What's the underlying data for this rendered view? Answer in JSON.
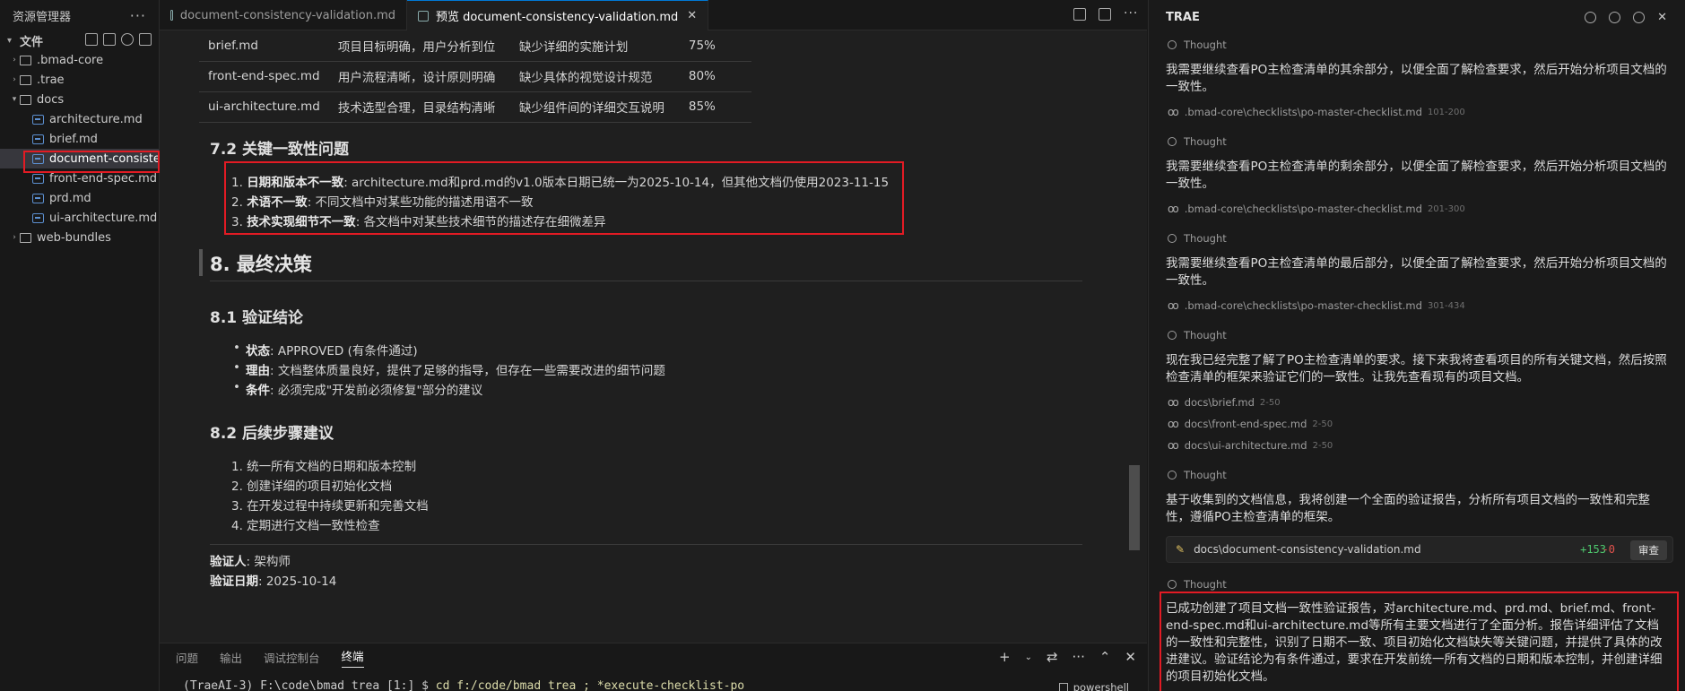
{
  "explorer": {
    "title": "资源管理器",
    "section": "文件",
    "items": [
      {
        "label": ".bmad-core",
        "type": "folder"
      },
      {
        "label": ".trae",
        "type": "folder"
      },
      {
        "label": "docs",
        "type": "folder-open"
      },
      {
        "label": "architecture.md",
        "type": "file"
      },
      {
        "label": "brief.md",
        "type": "file"
      },
      {
        "label": "document-consiste...",
        "type": "file"
      },
      {
        "label": "front-end-spec.md",
        "type": "file"
      },
      {
        "label": "prd.md",
        "type": "file"
      },
      {
        "label": "ui-architecture.md",
        "type": "file"
      },
      {
        "label": "web-bundles",
        "type": "folder"
      }
    ]
  },
  "tabs": [
    {
      "label": "document-consistency-validation.md"
    },
    {
      "label": "预览 document-consistency-validation.md"
    }
  ],
  "doc": {
    "table_rows": [
      [
        "brief.md",
        "项目目标明确，用户分析到位",
        "缺少详细的实施计划",
        "75%"
      ],
      [
        "front-end-spec.md",
        "用户流程清晰，设计原则明确",
        "缺少具体的视觉设计规范",
        "80%"
      ],
      [
        "ui-architecture.md",
        "技术选型合理，目录结构清晰",
        "缺少组件间的详细交互说明",
        "85%"
      ]
    ],
    "h72": "7.2 关键一致性问题",
    "issues": [
      {
        "num": "1.",
        "bold": "日期和版本不一致",
        "text": ": architecture.md和prd.md的v1.0版本日期已统一为2025-10-14，但其他文档仍使用2023-11-15"
      },
      {
        "num": "2.",
        "bold": "术语不一致",
        "text": ": 不同文档中对某些功能的描述用语不一致"
      },
      {
        "num": "3.",
        "bold": "技术实现细节不一致",
        "text": ": 各文档中对某些技术细节的描述存在细微差异"
      }
    ],
    "h8": "8. 最终决策",
    "h81": "8.1 验证结论",
    "conclusion": [
      {
        "bold": "状态",
        "text": ": APPROVED (有条件通过)"
      },
      {
        "bold": "理由",
        "text": ": 文档整体质量良好，提供了足够的指导，但存在一些需要改进的细节问题"
      },
      {
        "bold": "条件",
        "text": ": 必须完成\"开发前必须修复\"部分的建议"
      }
    ],
    "h82": "8.2 后续步骤建议",
    "steps": [
      "1. 统一所有文档的日期和版本控制",
      "2. 创建详细的项目初始化文档",
      "3. 在开发过程中持续更新和完善文档",
      "4. 定期进行文档一致性检查"
    ],
    "verifier_label": "验证人",
    "verifier": ": 架构师",
    "date_label": "验证日期",
    "date": ": 2025-10-14"
  },
  "panel": {
    "tabs": [
      "问题",
      "输出",
      "调试控制台",
      "终端"
    ],
    "terminal_prompt": "(TraeAI-3) F:\\code\\bmad_trea [1:] $ ",
    "terminal_cmd": "cd f:/code/bmad_trea ; *execute-checklist-po",
    "shell": "powershell"
  },
  "chat": {
    "title": "TRAE",
    "thought_label": "Thought",
    "messages": [
      "我需要继续查看PO主检查清单的其余部分，以便全面了解检查要求，然后开始分析项目文档的一致性。",
      "我需要继续查看PO主检查清单的剩余部分，以便全面了解检查要求，然后开始分析项目文档的一致性。",
      "我需要继续查看PO主检查清单的最后部分，以便全面了解检查要求，然后开始分析项目文档的一致性。",
      "现在我已经完整了解了PO主检查清单的要求。接下来我将查看项目的所有关键文档，然后按照检查清单的框架来验证它们的一致性。让我先查看现有的项目文档。",
      "基于收集到的文档信息，我将创建一个全面的验证报告，分析所有项目文档的一致性和完整性，遵循PO主检查清单的框架。",
      "已成功创建了项目文档一致性验证报告，对architecture.md、prd.md、brief.md、front-end-spec.md和ui-architecture.md等所有主要文档进行了全面分析。报告详细评估了文档的一致性和完整性，识别了日期不一致、项目初始化文档缺失等关键问题，并提供了具体的改进建议。验证结论为有条件通过，要求在开发前统一所有文档的日期和版本控制，并创建详细的项目初始化文档。"
    ],
    "refs": [
      {
        "path": ".bmad-core\\checklists\\po-master-checklist.md",
        "range": "101-200"
      },
      {
        "path": ".bmad-core\\checklists\\po-master-checklist.md",
        "range": "201-300"
      },
      {
        "path": ".bmad-core\\checklists\\po-master-checklist.md",
        "range": "301-434"
      },
      {
        "path": "docs\\brief.md",
        "range": "2-50"
      },
      {
        "path": "docs\\front-end-spec.md",
        "range": "2-50"
      },
      {
        "path": "docs\\ui-architecture.md",
        "range": "2-50"
      }
    ],
    "file_card": {
      "path": "docs\\document-consistency-validation.md",
      "added": "+153",
      "removed": "-0",
      "review_label": "审查"
    }
  }
}
